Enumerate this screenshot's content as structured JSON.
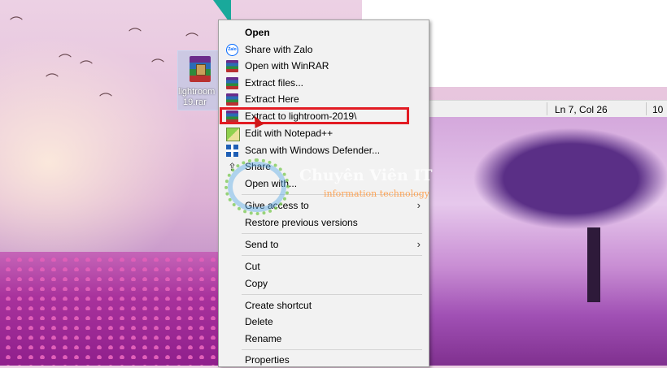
{
  "desktop": {
    "icon_label": "lightroom-2019.rar",
    "icon_label_lines": [
      "lightroom",
      "19.rar"
    ]
  },
  "notepad": {
    "status_position": "Ln 7, Col 26",
    "status_zoom": "10"
  },
  "context_menu": {
    "items": [
      {
        "label": "Open",
        "icon": "",
        "bold": true
      },
      {
        "label": "Share with Zalo",
        "icon": "zalo-icon"
      },
      {
        "label": "Open with WinRAR",
        "icon": "winrar-icon"
      },
      {
        "label": "Extract files...",
        "icon": "winrar-icon"
      },
      {
        "label": "Extract Here",
        "icon": "winrar-icon"
      },
      {
        "label": "Extract to lightroom-2019\\",
        "icon": "winrar-icon",
        "highlighted": true
      },
      {
        "label": "Edit with Notepad++",
        "icon": "notepad-plus-plus-icon"
      },
      {
        "label": "Scan with Windows Defender...",
        "icon": "windows-defender-icon"
      },
      {
        "label": "Share",
        "icon": "share-icon"
      },
      {
        "label": "Open with...",
        "icon": ""
      },
      {
        "label": "Give access to",
        "icon": "",
        "submenu": true
      },
      {
        "label": "Restore previous versions",
        "icon": ""
      },
      {
        "label": "Send to",
        "icon": "",
        "submenu": true
      },
      {
        "label": "Cut",
        "icon": ""
      },
      {
        "label": "Copy",
        "icon": ""
      },
      {
        "label": "Create shortcut",
        "icon": ""
      },
      {
        "label": "Delete",
        "icon": ""
      },
      {
        "label": "Rename",
        "icon": ""
      },
      {
        "label": "Properties",
        "icon": ""
      }
    ],
    "highlight_color": "#e21b23",
    "submenu_glyph": "›"
  },
  "watermark": {
    "title": "Chuyên Viên IT",
    "subtitle": "information technology"
  },
  "colors": {
    "menu_bg": "#f2f2f2",
    "accent_teal": "#19a99b"
  }
}
